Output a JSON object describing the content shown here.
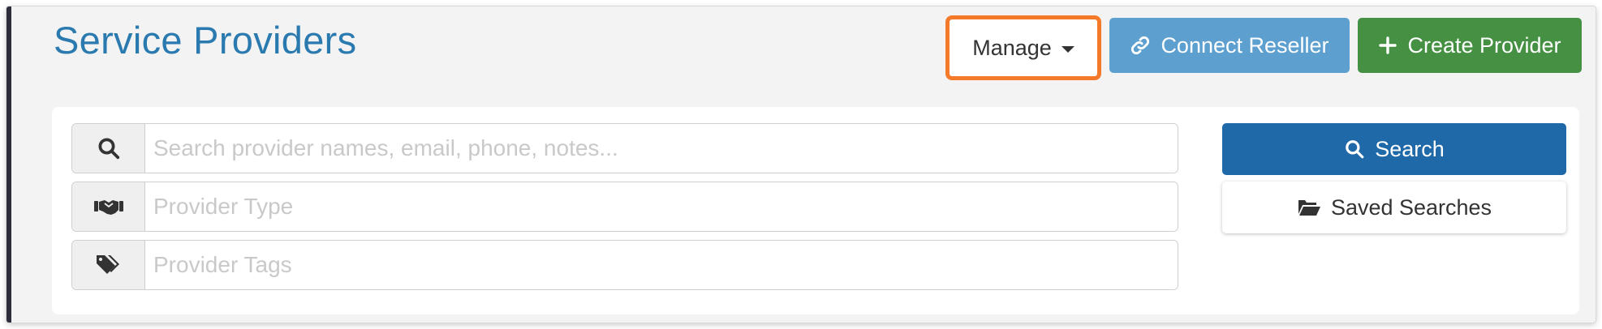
{
  "page": {
    "title": "Service Providers"
  },
  "toolbar": {
    "manage_label": "Manage",
    "connect_label": "Connect Reseller",
    "create_label": "Create Provider"
  },
  "filters": {
    "search": {
      "placeholder": "Search provider names, email, phone, notes...",
      "value": "",
      "icon": "search-icon"
    },
    "provider_type": {
      "placeholder": "Provider Type",
      "value": "",
      "icon": "handshake-icon"
    },
    "provider_tags": {
      "placeholder": "Provider Tags",
      "value": "",
      "icon": "tags-icon"
    }
  },
  "actions": {
    "search_label": "Search",
    "saved_label": "Saved Searches"
  },
  "colors": {
    "title": "#2a7ab0",
    "highlight": "#f47a2a",
    "connect": "#5da0d0",
    "create": "#459042",
    "search": "#1f69a8"
  }
}
